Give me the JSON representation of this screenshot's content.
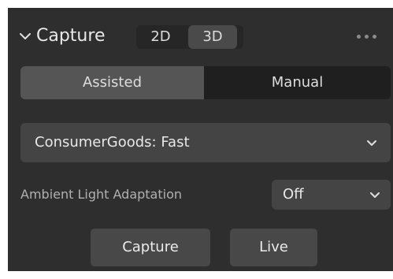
{
  "header": {
    "title": "Capture",
    "dimension_options": [
      "2D",
      "3D"
    ],
    "selected_dimension": "3D",
    "collapse_icon": "chevron-down-icon",
    "more_icon": "ellipsis-icon"
  },
  "mode": {
    "options": [
      "Assisted",
      "Manual"
    ],
    "selected": "Assisted"
  },
  "preset": {
    "value": "ConsumerGoods: Fast",
    "icon": "chevron-down-icon"
  },
  "ambient": {
    "label": "Ambient Light Adaptation",
    "value": "Off",
    "icon": "chevron-down-icon"
  },
  "actions": {
    "capture_label": "Capture",
    "live_label": "Live"
  },
  "colors": {
    "panel_bg": "#2e2e2e",
    "selected_bg": "#555555",
    "dropdown_bg": "#444444",
    "text": "#e6e6e6",
    "muted_text": "#b0b0b0"
  }
}
